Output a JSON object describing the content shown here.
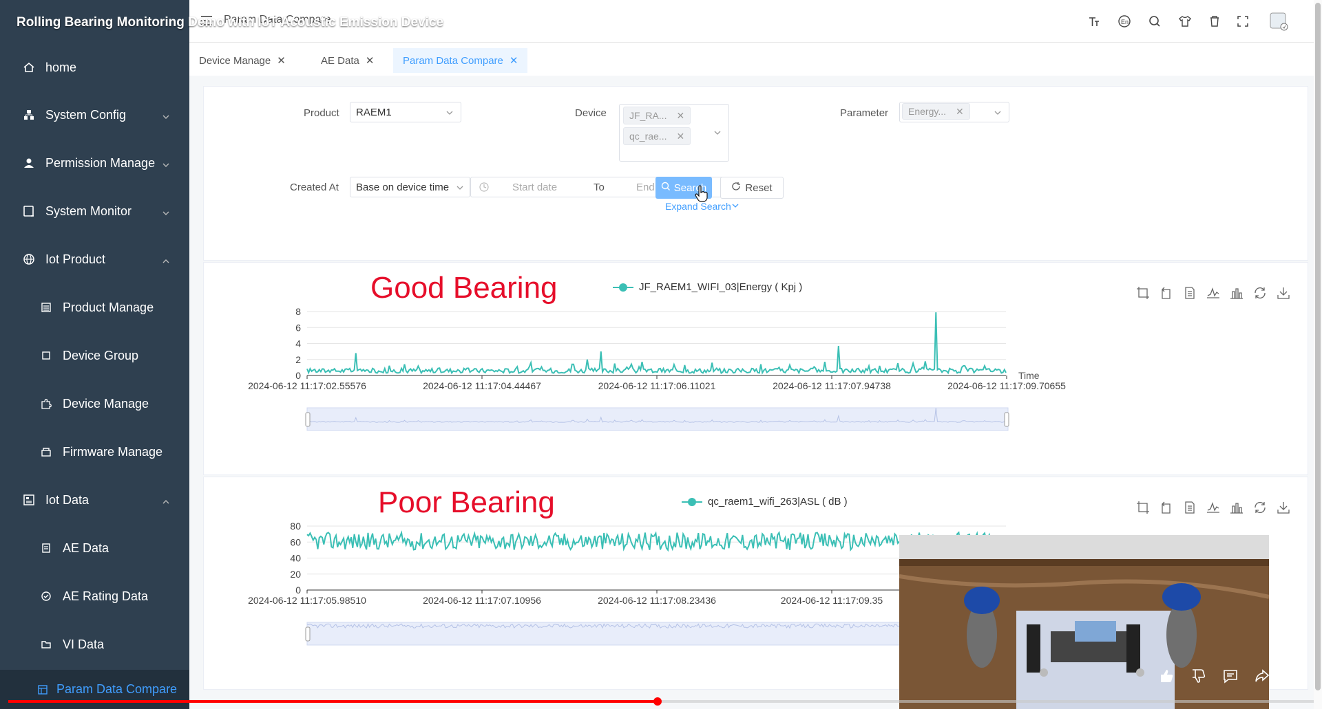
{
  "video_title": "Rolling Bearing Monitoring Demo with IoT Acoustic Emission Device",
  "sidebar": {
    "items": [
      {
        "label": "home",
        "icon": "home-icon"
      },
      {
        "label": "System Config",
        "icon": "sitemap-icon"
      },
      {
        "label": "Permission Manage",
        "icon": "user-icon"
      },
      {
        "label": "System Monitor",
        "icon": "monitor-icon"
      },
      {
        "label": "Iot Product",
        "icon": "globe-icon"
      },
      {
        "label": "Product Manage",
        "icon": "list-icon"
      },
      {
        "label": "Device Group",
        "icon": "square-icon"
      },
      {
        "label": "Device Manage",
        "icon": "puzzle-icon"
      },
      {
        "label": "Firmware Manage",
        "icon": "box-icon"
      },
      {
        "label": "Iot Data",
        "icon": "data-icon"
      },
      {
        "label": "AE Data",
        "icon": "doc-icon"
      },
      {
        "label": "AE Rating Data",
        "icon": "rating-icon"
      },
      {
        "label": "VI Data",
        "icon": "folder-icon"
      },
      {
        "label": "Param Data Compare",
        "icon": "compare-icon"
      }
    ]
  },
  "header": {
    "breadcrumb": "Param Data Compare"
  },
  "tabs": [
    {
      "label": "Device Manage"
    },
    {
      "label": "AE Data"
    },
    {
      "label": "Param Data Compare"
    }
  ],
  "search": {
    "product_label": "Product",
    "product_value": "RAEM1",
    "device_label": "Device",
    "device_tags": [
      "JF_RA...",
      "qc_rae..."
    ],
    "parameter_label": "Parameter",
    "parameter_tag": "Energy...",
    "created_label": "Created At",
    "created_mode": "Base on device time",
    "start_placeholder": "Start date",
    "to": "To",
    "end_placeholder": "End date",
    "search_button": "Search",
    "reset_button": "Reset",
    "expand": "Expand Search"
  },
  "colors": {
    "series": "#3bbfb5",
    "accent": "#409eff",
    "title_red": "#e60e2a"
  },
  "overlays": {
    "good": "Good Bearing",
    "poor": "Poor Bearing"
  },
  "chart_data": [
    {
      "type": "line",
      "series": [
        {
          "name": "JF_RAEM1_WIFI_03|Energy ( Kpj )"
        }
      ],
      "xlabel": "Time",
      "x_ticks": [
        "2024-06-12 11:17:02.55576",
        "2024-06-12 11:17:04.44467",
        "2024-06-12 11:17:06.11021",
        "2024-06-12 11:17:07.94738",
        "2024-06-12 11:17:09.70655"
      ],
      "y_ticks": [
        "0",
        "2",
        "4",
        "6",
        "8"
      ],
      "ylim": [
        0,
        8
      ],
      "baseline": 0.3,
      "spikes": [
        [
          0.07,
          2.8
        ],
        [
          0.14,
          1.4
        ],
        [
          0.23,
          0.9
        ],
        [
          0.3,
          1.1
        ],
        [
          0.32,
          1.6
        ],
        [
          0.38,
          1.4
        ],
        [
          0.4,
          2.0
        ],
        [
          0.42,
          3.0
        ],
        [
          0.44,
          1.5
        ],
        [
          0.48,
          1.7
        ],
        [
          0.54,
          1.3
        ],
        [
          0.58,
          1.6
        ],
        [
          0.65,
          1.4
        ],
        [
          0.69,
          1.3
        ],
        [
          0.74,
          1.7
        ],
        [
          0.76,
          3.7
        ],
        [
          0.82,
          1.2
        ],
        [
          0.9,
          7.9
        ],
        [
          0.94,
          1.2
        ],
        [
          0.97,
          1.2
        ]
      ],
      "grid": true
    },
    {
      "type": "line",
      "series": [
        {
          "name": "qc_raem1_wifi_263|ASL ( dB )"
        }
      ],
      "x_ticks": [
        "2024-06-12 11:17:05.98510",
        "2024-06-12 11:17:07.10956",
        "2024-06-12 11:17:08.23436",
        "2024-06-12 11:17:09.35"
      ],
      "y_ticks": [
        "0",
        "20",
        "40",
        "60",
        "80"
      ],
      "ylim": [
        0,
        80
      ],
      "band": [
        50,
        72
      ],
      "grid": true
    }
  ]
}
